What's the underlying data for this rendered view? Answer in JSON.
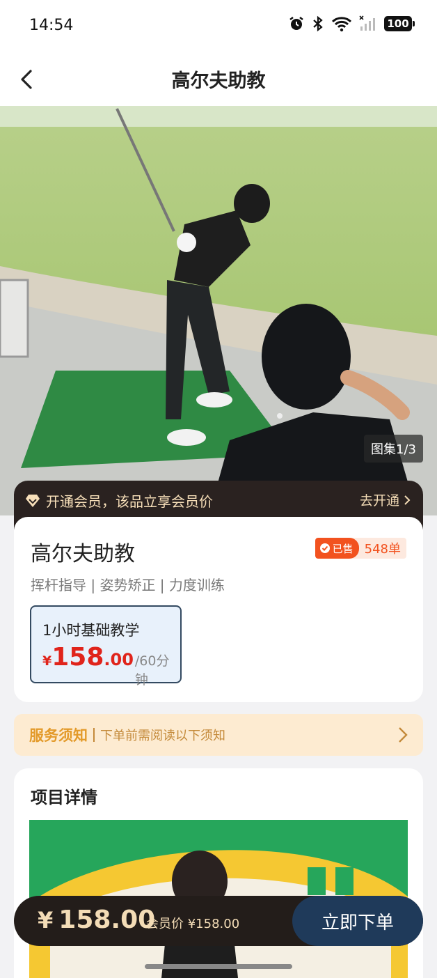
{
  "status_bar": {
    "time": "14:54",
    "battery": "100"
  },
  "nav": {
    "title": "高尔夫助教",
    "back_icon": "chevron-left-icon"
  },
  "hero": {
    "gallery_label": "图集1/3"
  },
  "member_banner": {
    "text": "开通会员，该品立享会员价",
    "action": "去开通"
  },
  "product": {
    "name": "高尔夫助教",
    "sold_tag": "已售",
    "sold_count": "548单",
    "tags": "挥杆指导 | 姿势矫正 | 力度训练",
    "package": {
      "name": "1小时基础教学",
      "currency": "¥",
      "price_int": "158",
      "price_dec": ".00",
      "unit": "/60分钟"
    }
  },
  "service_notice": {
    "title": "服务须知",
    "text": "下单前需阅读以下须知"
  },
  "details": {
    "title": "项目详情"
  },
  "bottom_bar": {
    "currency": "¥",
    "price": "158.00",
    "member_price": "会员价 ¥158.00",
    "order_button": "立即下单"
  },
  "colors": {
    "accent_red": "#e0241b",
    "member_gold": "#f3dcb6",
    "order_button": "#1f3a5a",
    "sold_orange": "#f2521f"
  }
}
